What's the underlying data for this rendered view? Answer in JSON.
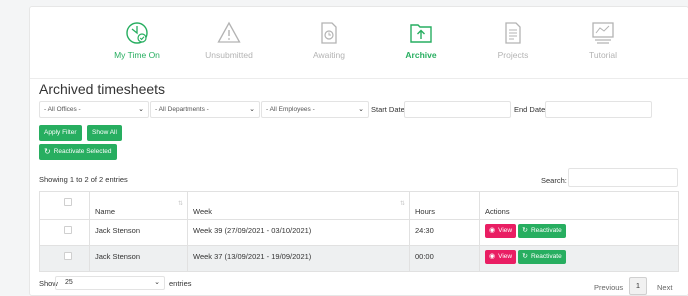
{
  "nav": {
    "items": [
      {
        "label": "My Time On",
        "icon": "clock-check-icon"
      },
      {
        "label": "Unsubmitted",
        "icon": "warning-triangle-icon"
      },
      {
        "label": "Awaiting",
        "icon": "clock-document-icon"
      },
      {
        "label": "Archive",
        "icon": "archive-folder-icon"
      },
      {
        "label": "Projects",
        "icon": "projects-document-icon"
      },
      {
        "label": "Tutorial",
        "icon": "tutorial-presentation-icon"
      }
    ]
  },
  "title": "Archived timesheets",
  "filters": {
    "offices": "- All Offices -",
    "departments": "- All Departments -",
    "employees": "- All Employees -",
    "start_date_label": "Start Date",
    "end_date_label": "End Date"
  },
  "buttons": {
    "apply_filter": "Apply Filter",
    "show_all": "Show All",
    "reactivate_selected": "Reactivate Selected"
  },
  "table": {
    "info": "Showing 1 to 2 of 2 entries",
    "search_label": "Search:",
    "headers": {
      "name": "Name",
      "week": "Week",
      "hours": "Hours",
      "actions": "Actions"
    },
    "rows": [
      {
        "name": "Jack Stenson",
        "week": "Week 39 (27/09/2021 - 03/10/2021)",
        "hours": "24:30"
      },
      {
        "name": "Jack Stenson",
        "week": "Week 37 (13/09/2021 - 19/09/2021)",
        "hours": "00:00"
      }
    ],
    "view_label": "View",
    "reactivate_label": "Reactivate"
  },
  "footer": {
    "show_label": "Show",
    "page_length": "25",
    "entries_label": "entries",
    "previous": "Previous",
    "page": "1",
    "next": "Next"
  },
  "colors": {
    "accent": "#27ae60",
    "view": "#e91e63",
    "muted": "#b3b3b3"
  }
}
